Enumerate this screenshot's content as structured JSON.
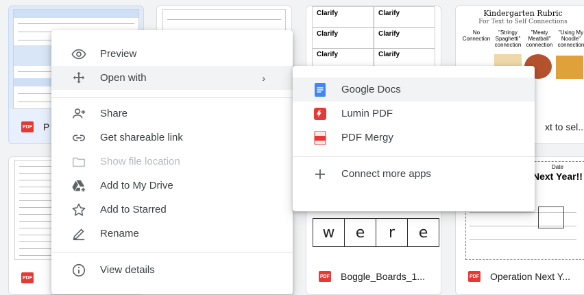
{
  "colors": {
    "hover": "#f1f3f4",
    "pdf_red": "#e53935",
    "docs_blue": "#4285f4",
    "text": "#3c4043"
  },
  "files": [
    {
      "name": "P",
      "icon": "pdf-icon",
      "selected": true
    },
    {
      "name": ""
    },
    {
      "name": ""
    },
    {
      "name": "xt to sel...",
      "icon": "pdf-icon"
    },
    {
      "name": "",
      "icon": "pdf-icon"
    },
    {
      "name": "Boggle_Boards_1...",
      "icon": "pdf-icon"
    },
    {
      "name": "Operation Next Y...",
      "icon": "pdf-icon"
    }
  ],
  "pdf_badge": "PDF",
  "thumbs": {
    "clarify": [
      "Clarify",
      "Clarify",
      "Clarify",
      "Clarify",
      "Clarify",
      "Clarify"
    ],
    "rubric": {
      "title": "Kindergarten Rubric",
      "subtitle": "For Text to Self Connections",
      "cols": [
        "No Connection",
        "\"Stringy Spaghetti\" connection",
        "\"Meaty Meatball\" connection",
        "\"Using My Noodle\" connection"
      ]
    },
    "boggle_letters": [
      "w",
      "e",
      "r",
      "e"
    ],
    "operation": {
      "heading": "Next Year!!",
      "date": "Date"
    }
  },
  "context_menu": {
    "items": [
      {
        "label": "Preview",
        "icon": "eye-icon"
      },
      {
        "label": "Open with",
        "icon": "move-icon",
        "submenu": true
      },
      {
        "label": "Share",
        "icon": "person-add-icon"
      },
      {
        "label": "Get shareable link",
        "icon": "link-icon"
      },
      {
        "label": "Show file location",
        "icon": "folder-icon",
        "disabled": true
      },
      {
        "label": "Add to My Drive",
        "icon": "drive-add-icon"
      },
      {
        "label": "Add to Starred",
        "icon": "star-icon"
      },
      {
        "label": "Rename",
        "icon": "pencil-icon"
      },
      {
        "label": "View details",
        "icon": "info-icon"
      }
    ],
    "chevron": "›"
  },
  "open_with_menu": {
    "apps": [
      {
        "label": "Google Docs",
        "icon": "google-docs-icon"
      },
      {
        "label": "Lumin PDF",
        "icon": "lumin-pdf-icon"
      },
      {
        "label": "PDF Mergy",
        "icon": "pdf-mergy-icon"
      }
    ],
    "connect": {
      "label": "Connect more apps",
      "icon": "plus-icon"
    }
  }
}
